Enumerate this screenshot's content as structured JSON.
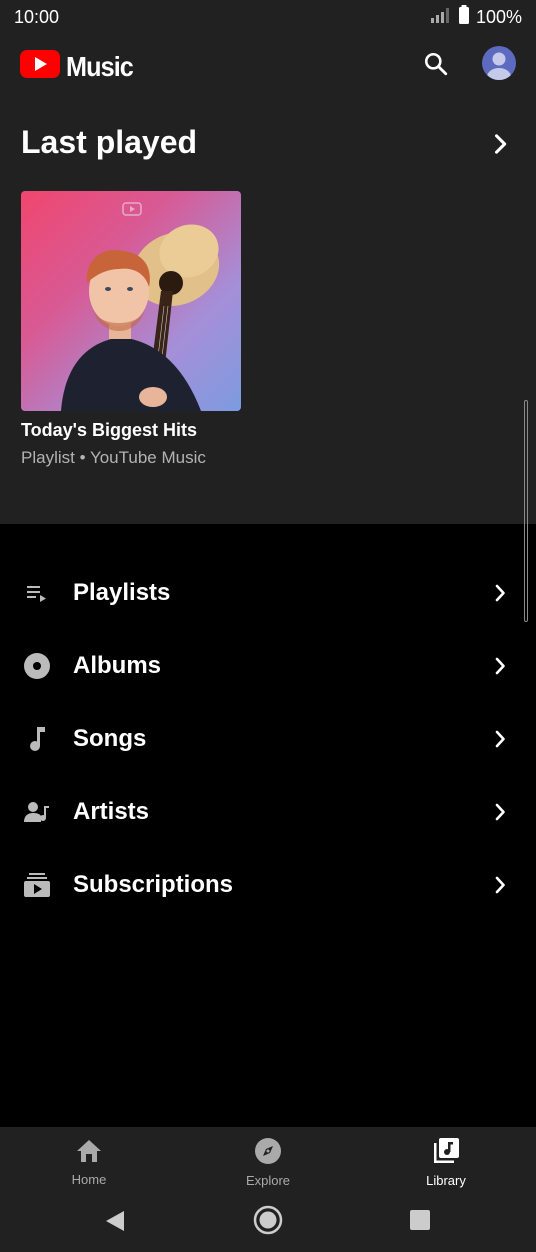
{
  "status_bar": {
    "time": "10:00",
    "battery": "100%"
  },
  "app_bar": {
    "logo_text": "Music",
    "brand_color": "#ff0000"
  },
  "last_played": {
    "heading": "Last played",
    "cards": [
      {
        "title": "Today's Biggest Hits",
        "subtitle": "Playlist • YouTube Music"
      }
    ]
  },
  "library": {
    "items": [
      {
        "label": "Playlists",
        "icon": "playlist-icon"
      },
      {
        "label": "Albums",
        "icon": "album-icon"
      },
      {
        "label": "Songs",
        "icon": "music-note-icon"
      },
      {
        "label": "Artists",
        "icon": "artist-icon"
      },
      {
        "label": "Subscriptions",
        "icon": "subscriptions-icon"
      }
    ]
  },
  "bottom_nav": {
    "items": [
      {
        "label": "Home",
        "icon": "home-icon",
        "active": false
      },
      {
        "label": "Explore",
        "icon": "compass-icon",
        "active": false
      },
      {
        "label": "Library",
        "icon": "library-icon",
        "active": true
      }
    ]
  }
}
